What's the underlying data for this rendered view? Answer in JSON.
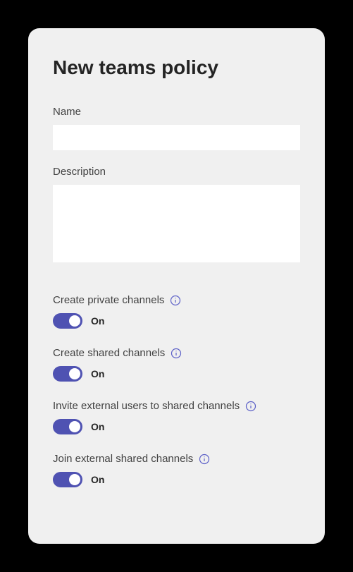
{
  "title": "New teams policy",
  "fields": {
    "name": {
      "label": "Name",
      "value": ""
    },
    "description": {
      "label": "Description",
      "value": ""
    }
  },
  "settings": [
    {
      "label": "Create private channels",
      "state": "On",
      "enabled": true
    },
    {
      "label": "Create shared channels",
      "state": "On",
      "enabled": true
    },
    {
      "label": "Invite external users to shared channels",
      "state": "On",
      "enabled": true
    },
    {
      "label": "Join external shared channels",
      "state": "On",
      "enabled": true
    }
  ],
  "colors": {
    "accent": "#4f52b2",
    "panel_bg": "#f0f0f0",
    "text_primary": "#242424",
    "text_secondary": "#424242"
  }
}
